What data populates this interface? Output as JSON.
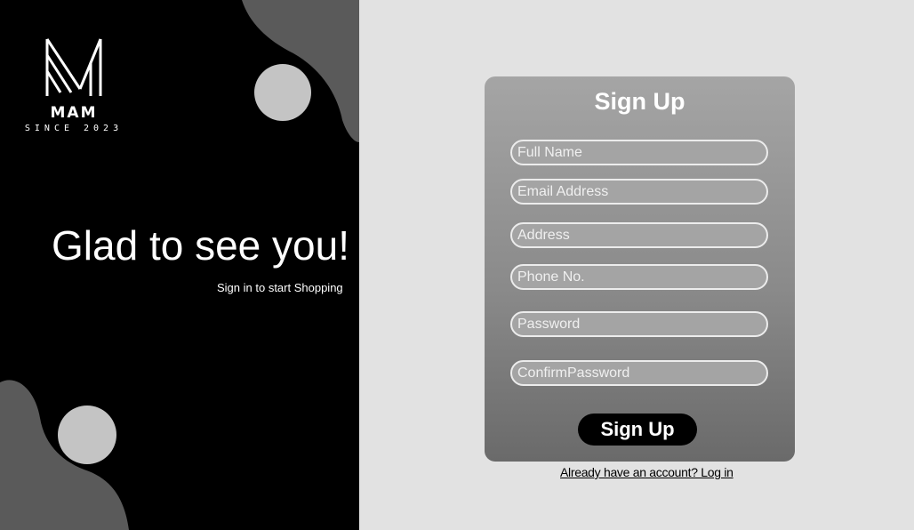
{
  "brand": {
    "name": "MAM",
    "tagline": "SINCE 2023"
  },
  "hero": {
    "greeting": "Glad to see you!",
    "subtext": "Sign in to start Shopping"
  },
  "signup_form": {
    "title": "Sign Up",
    "fields": {
      "full_name": {
        "placeholder": "Full Name"
      },
      "email": {
        "placeholder": "Email Address"
      },
      "address": {
        "placeholder": "Address"
      },
      "phone": {
        "placeholder": "Phone No."
      },
      "password": {
        "placeholder": "Password"
      },
      "confirm_password": {
        "placeholder": "ConfirmPassword"
      }
    },
    "submit_label": "Sign Up",
    "login_link": "Already have an account? Log in"
  },
  "colors": {
    "left_panel_bg": "#000000",
    "page_bg": "#e2e2e2",
    "blob_dark": "#5a5a5a",
    "circle_light": "#c4c4c4",
    "button_bg": "#000000"
  }
}
